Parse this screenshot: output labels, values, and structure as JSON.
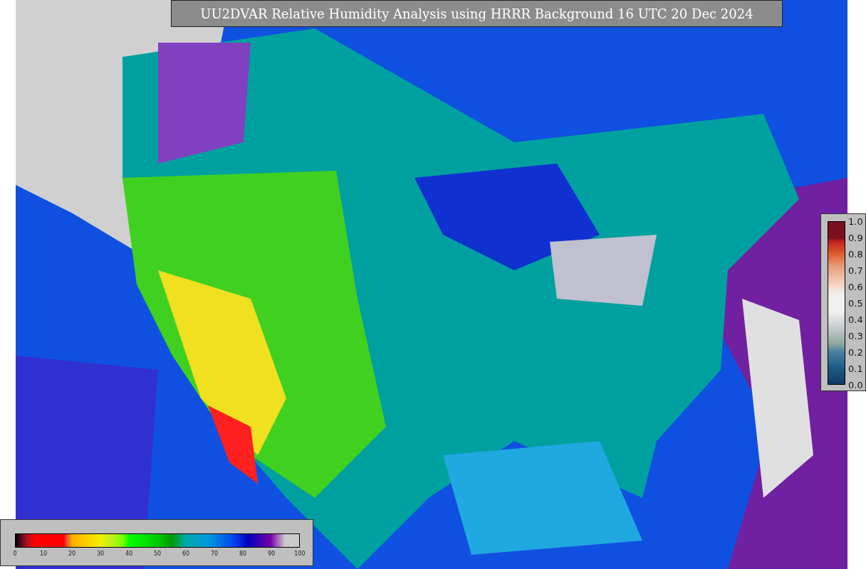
{
  "title": "UU2DVAR Relative Humidity Analysis using HRRR Background 16 UTC 20 Dec 2024",
  "humidity_colorbar": {
    "ticks": [
      "0",
      "10",
      "20",
      "30",
      "40",
      "50",
      "60",
      "70",
      "80",
      "90",
      "100"
    ]
  },
  "observation_colorbar": {
    "ticks": [
      "1.0",
      "0.9",
      "0.8",
      "0.7",
      "0.6",
      "0.5",
      "0.4",
      "0.3",
      "0.2",
      "0.1",
      "0.0"
    ]
  }
}
